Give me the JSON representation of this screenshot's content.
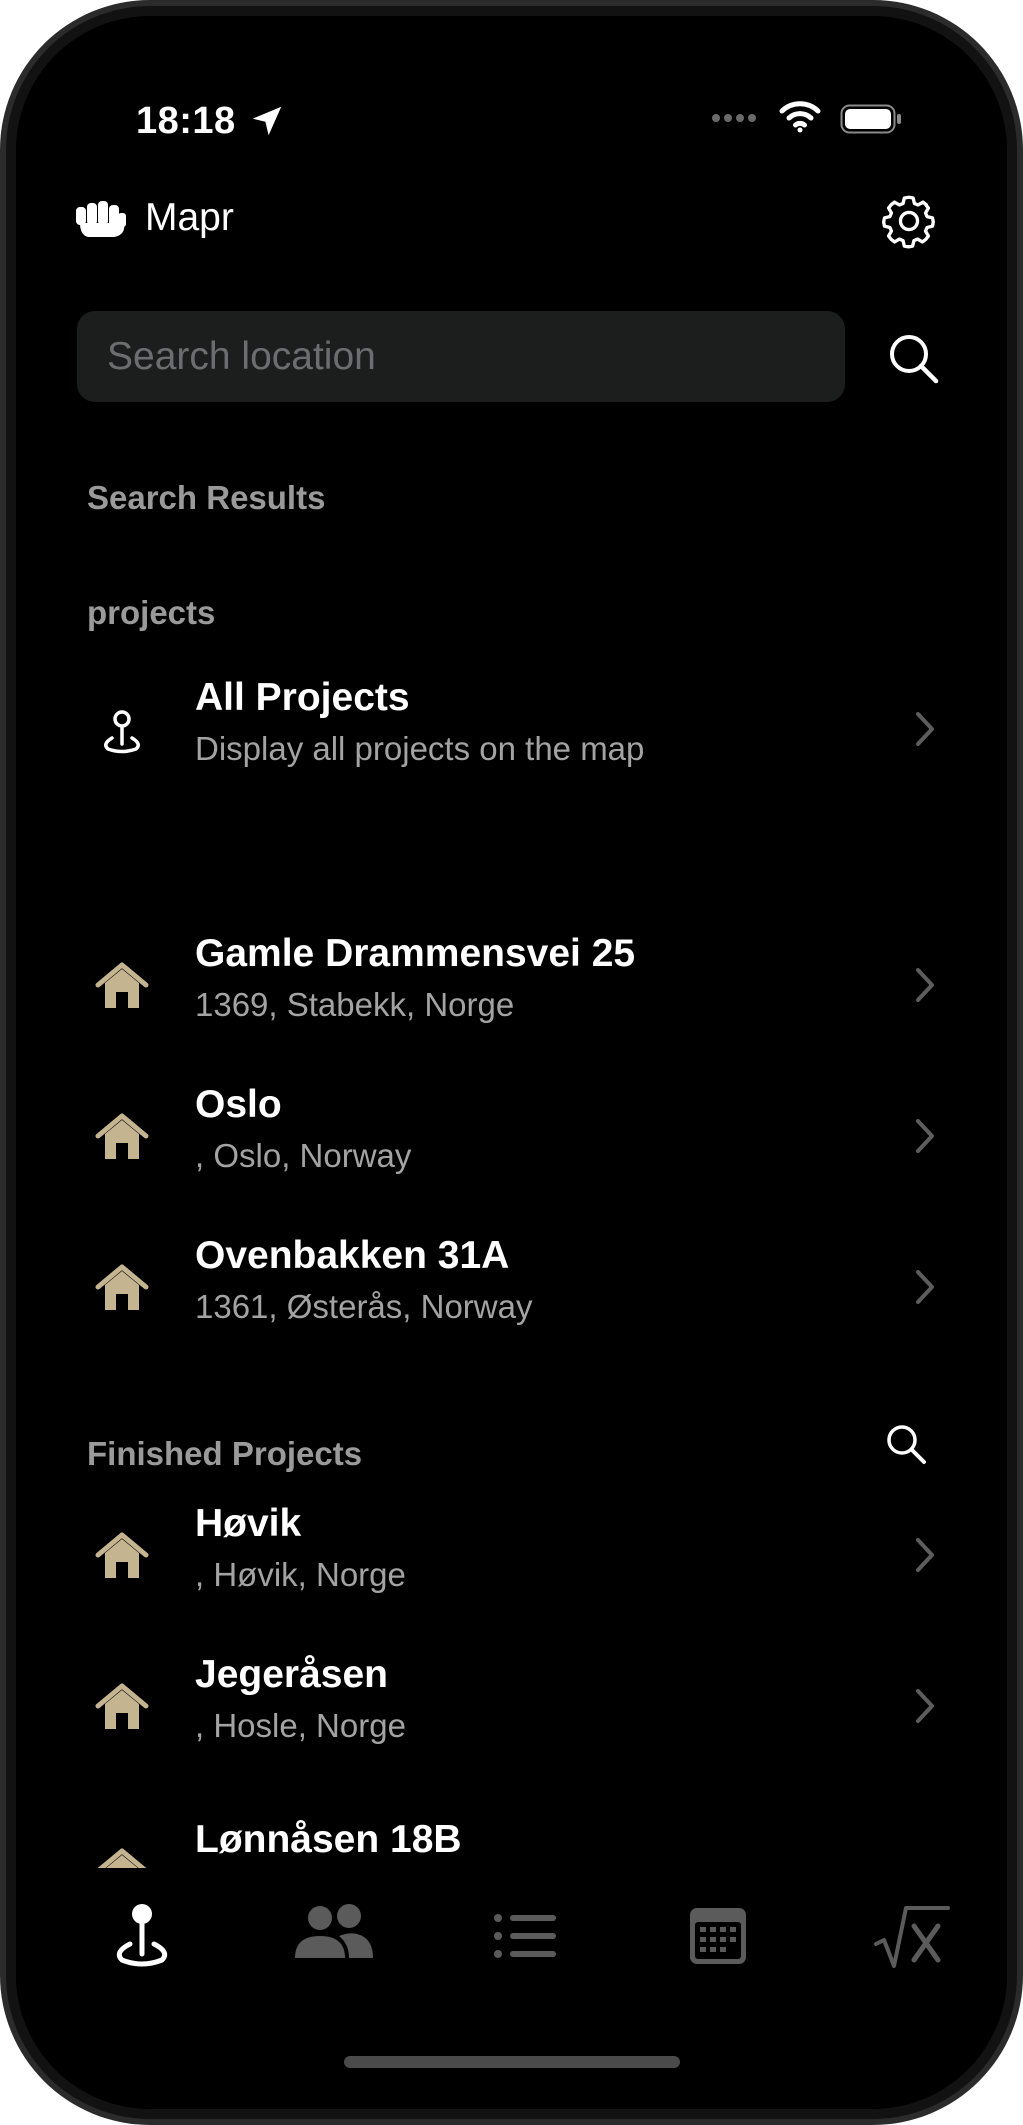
{
  "status_bar": {
    "time": "18:18"
  },
  "header": {
    "app_name": "Mapr"
  },
  "search": {
    "placeholder": "Search location",
    "value": ""
  },
  "sections": {
    "search_results_label": "Search Results",
    "projects_label": "projects",
    "finished_label": "Finished Projects"
  },
  "all_projects": {
    "title": "All Projects",
    "subtitle": "Display all projects on the map"
  },
  "projects": [
    {
      "title": "Gamle Drammensvei 25",
      "subtitle": "1369, Stabekk, Norge"
    },
    {
      "title": "Oslo",
      "subtitle": ", Oslo, Norway"
    },
    {
      "title": "Ovenbakken 31A",
      "subtitle": "1361, Østerås, Norway"
    }
  ],
  "finished_projects": [
    {
      "title": "Høvik",
      "subtitle": ", Høvik, Norge"
    },
    {
      "title": "Jegeråsen",
      "subtitle": ", Hosle, Norge"
    },
    {
      "title": "Lønnåsen 18B",
      "subtitle": ""
    }
  ],
  "tabs": [
    {
      "icon": "map-pin-icon",
      "active": true
    },
    {
      "icon": "people-icon",
      "active": false
    },
    {
      "icon": "list-icon",
      "active": false
    },
    {
      "icon": "calendar-icon",
      "active": false
    },
    {
      "icon": "square-root-icon",
      "active": false
    }
  ],
  "colors": {
    "background": "#000000",
    "house_icon": "#c4b590",
    "secondary_text": "#a3a3a3",
    "section_text": "#9a9a9a",
    "inactive_tab": "#5b5b5b",
    "search_field": "#1c1e1e"
  }
}
